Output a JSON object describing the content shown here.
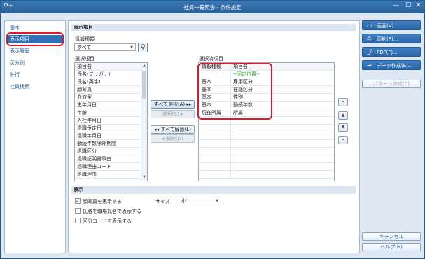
{
  "window": {
    "title": "社員一覧照会 - 条件設定",
    "icon": "search-plus-icon"
  },
  "sidebar": {
    "items": [
      {
        "label": "基本"
      },
      {
        "label": "表示項目"
      },
      {
        "label": "表示履歴"
      },
      {
        "label": "区分別"
      },
      {
        "label": "貯行"
      },
      {
        "label": "社員検索"
      }
    ],
    "active_index": 1
  },
  "display_items": {
    "heading": "表示項目",
    "info_type_label": "情報種類",
    "info_type_value": "すべて",
    "selection_label": "選択項目",
    "selection_header": "項目名",
    "selection_items": [
      "氏名(フリガナ)",
      "氏名(英字)",
      "顔写真",
      "血液型",
      "生年月日",
      "年齢",
      "入社年月日",
      "退職予定日",
      "退職年月日",
      "勤続年数除外期間",
      "退職区分",
      "退職証明書事由",
      "退職理由コード",
      "退職理由"
    ],
    "selected_label": "選択済項目",
    "selected_headers": [
      "情報種類",
      "項目名"
    ],
    "selected_rows": [
      {
        "type": "",
        "name": "--固定位置--"
      },
      {
        "type": "基本",
        "name": "雇用区分"
      },
      {
        "type": "基本",
        "name": "在籍区分"
      },
      {
        "type": "基本",
        "name": "性別"
      },
      {
        "type": "基本",
        "name": "勤続年数"
      },
      {
        "type": "現在所属",
        "name": "所属"
      }
    ],
    "buttons": {
      "select_all": "すべて選択(A)",
      "select": "選択(S)",
      "deselect_all": "すべて解除(L)",
      "deselect": "解除(D)"
    }
  },
  "display_section": {
    "heading": "表示",
    "options": [
      {
        "label": "顔写真を表示する",
        "checked": true
      },
      {
        "label": "氏名を職場氏名で表示する",
        "checked": false
      },
      {
        "label": "区分コードを表示する",
        "checked": false
      }
    ],
    "size_label": "サイズ",
    "size_value": "小"
  },
  "actions": {
    "screen": "画面(V)",
    "print": "印刷(P)...",
    "pdf": "PDF(F)...",
    "data": "データ作成(E)...",
    "pattern": "パターン作成(C)",
    "cancel": "キャンセル",
    "help": "ヘルプ(H)"
  },
  "colors": {
    "accent": "#2e6fb5",
    "highlight": "#e2162c",
    "fixed_position": "#2a9a2a"
  }
}
